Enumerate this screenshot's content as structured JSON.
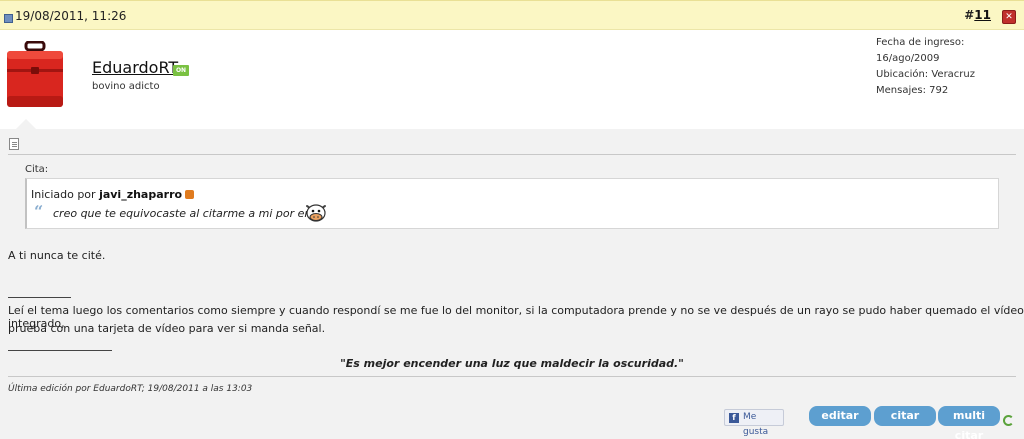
{
  "header": {
    "date": "19/08/2011, 11:26",
    "post_number_prefix": "#",
    "post_number": "11",
    "report_icon": "report-icon"
  },
  "user": {
    "username": "EduardoRT",
    "online_badge": "ON",
    "title": "bovino adicto",
    "join_date": "Fecha de ingreso: 16/ago/2009",
    "location": "Ubicación: Veracruz",
    "posts": "Mensajes: 792",
    "avatar_icon": "red-toolbox-icon"
  },
  "quote": {
    "label": "Cita:",
    "started_by": "Iniciado por",
    "author": "javi_zhaparro",
    "marks": "“",
    "text": "creo que te equivocaste al citarme a mi por error",
    "smiley": "cow-smiley-icon"
  },
  "message": {
    "line1": "A ti nunca te cité.",
    "line2": "Leí el tema luego los comentarios como siempre y cuando respondí se me fue lo del monitor, si la computadora prende y no se ve después de un rayo se pudo haber quemado el vídeo integrado,",
    "line3": "prueba con una tarjeta de vídeo para ver si manda señal."
  },
  "signature": {
    "text": "\"Es mejor encender una luz que maldecir la oscuridad.\""
  },
  "edit_note": "Última edición por EduardoRT; 19/08/2011 a las 13:03",
  "actions": {
    "like": "Me gusta",
    "like_icon": "f",
    "edit": "editar",
    "quote": "citar",
    "multiquote": "multi citar"
  },
  "colors": {
    "header_bg": "#fbf7c4",
    "button_blue": "#5d9fd0",
    "online_green": "#7ac142"
  }
}
